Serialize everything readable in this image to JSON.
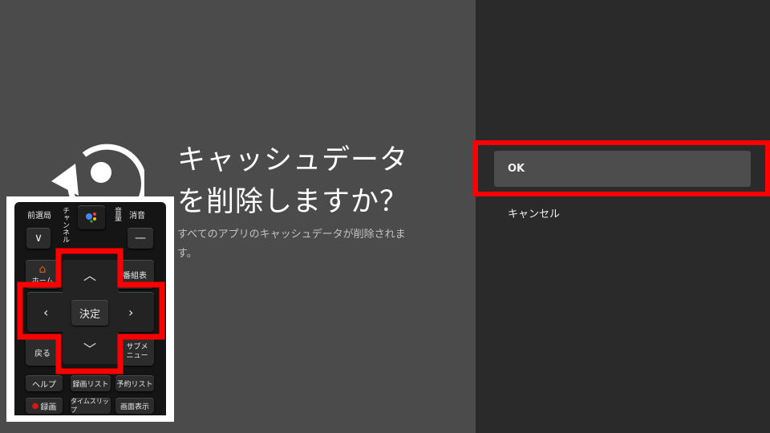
{
  "dialog": {
    "title_line1": "キャッシュデータ",
    "title_line2": "を削除しますか？",
    "description_line1": "すべてのアプリのキャッシュデータが削除されま",
    "description_line2": "す。",
    "icon": "reset-icon"
  },
  "options": [
    {
      "label": "OK",
      "selected": true
    },
    {
      "label": "キャンセル",
      "selected": false
    }
  ],
  "remote": {
    "prev_station": "前選局",
    "channel": "チャンネル",
    "volume": "音量",
    "mute": "消音",
    "home": "ホーム",
    "program_guide": "番組表",
    "enter": "決定",
    "back": "戻る",
    "sub_menu": "サブメニュー",
    "help": "ヘルプ",
    "recording_list": "録画リスト",
    "reservation_list": "予約リスト",
    "record": "録画",
    "time_slip": "タイムスリップ",
    "screen_display": "画面表示"
  },
  "colors": {
    "highlight": "#ff0000",
    "left_bg": "#4b4b4b",
    "right_bg": "#2a2a2a",
    "selected_option_bg": "#4d4d4d",
    "home_icon": "#e05a1a",
    "record_dot": "#d01818"
  }
}
